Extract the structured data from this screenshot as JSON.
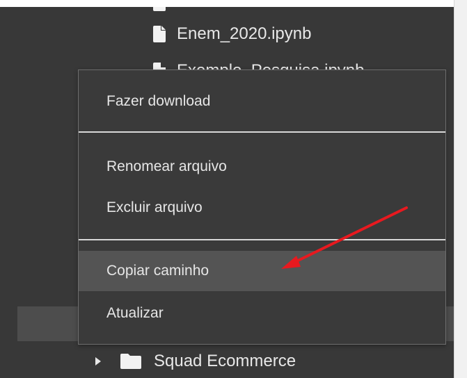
{
  "file_browser": {
    "files": [
      {
        "name": "Enem_2020.ipynb",
        "icon": "file-icon"
      },
      {
        "name": "Exemplo_Pesquisa.ipynb",
        "icon": "file-icon"
      }
    ],
    "folder": {
      "name": "Squad Ecommerce",
      "icon": "folder-icon",
      "expander": "caret-right-icon"
    }
  },
  "context_menu": {
    "items": [
      {
        "label": "Fazer download",
        "active": false
      },
      {
        "label": "Renomear arquivo",
        "active": false
      },
      {
        "label": "Excluir arquivo",
        "active": false
      },
      {
        "label": "Copiar caminho",
        "active": true
      },
      {
        "label": "Atualizar",
        "active": false
      }
    ]
  },
  "annotation": {
    "color": "#e8191f",
    "icon": "red-arrow-annotation"
  },
  "colors": {
    "panel_bg": "#383838",
    "menu_bg": "#3a3a3a",
    "hover_bg": "#545454",
    "text": "#e6e6e6"
  }
}
